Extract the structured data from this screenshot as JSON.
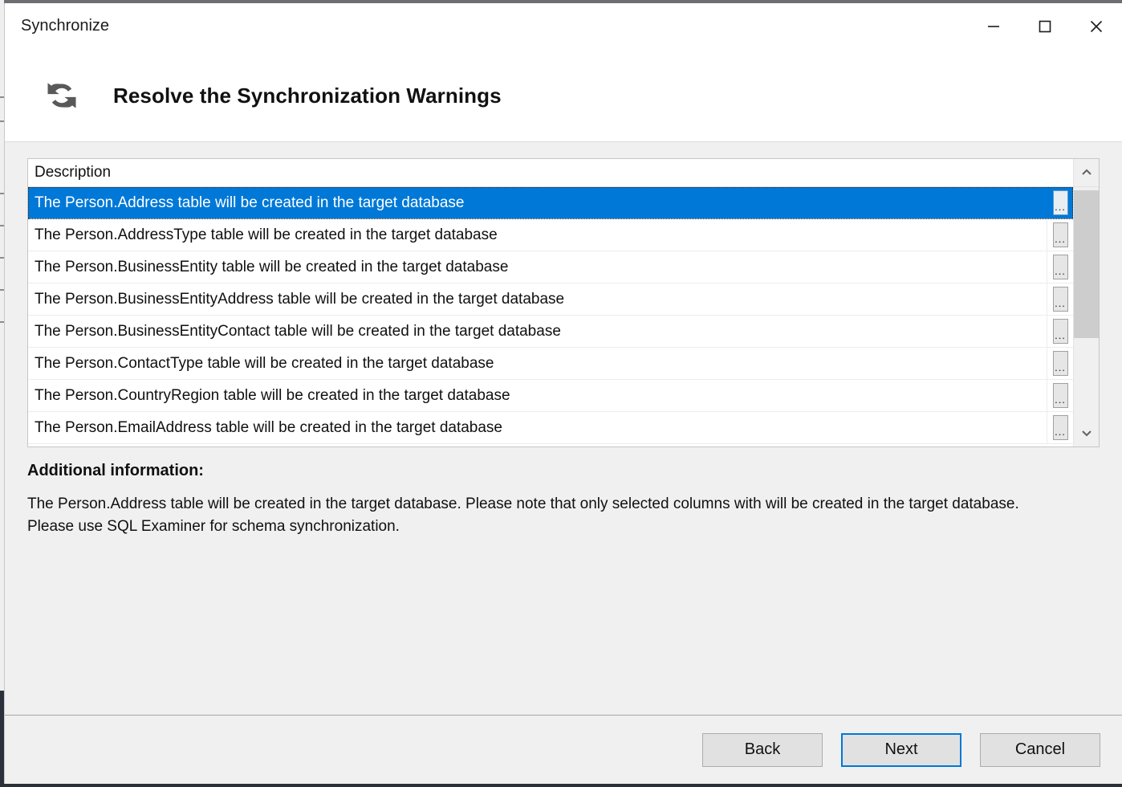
{
  "window": {
    "title": "Synchronize",
    "controls": {
      "minimize": "minimize-button",
      "maximize": "maximize-button",
      "close": "close-button"
    }
  },
  "header": {
    "icon": "sync-refresh-icon",
    "title": "Resolve the Synchronization Warnings"
  },
  "list": {
    "columns": [
      "Description"
    ],
    "rows": [
      {
        "description": "The Person.Address table will be created in the target database",
        "selected": true,
        "action_label": "..."
      },
      {
        "description": "The Person.AddressType table will be created in the target database",
        "selected": false,
        "action_label": "..."
      },
      {
        "description": "The Person.BusinessEntity table will be created in the target database",
        "selected": false,
        "action_label": "..."
      },
      {
        "description": "The Person.BusinessEntityAddress table will be created in the target database",
        "selected": false,
        "action_label": "..."
      },
      {
        "description": "The Person.BusinessEntityContact table will be created in the target database",
        "selected": false,
        "action_label": "..."
      },
      {
        "description": "The Person.ContactType table will be created in the target database",
        "selected": false,
        "action_label": "..."
      },
      {
        "description": "The Person.CountryRegion table will be created in the target database",
        "selected": false,
        "action_label": "..."
      },
      {
        "description": "The Person.EmailAddress table will be created in the target database",
        "selected": false,
        "action_label": "..."
      }
    ],
    "scrollbar": {
      "up_icon": "chevron-up-icon",
      "down_icon": "chevron-down-icon"
    }
  },
  "additional_information": {
    "label": "Additional information:",
    "text": "The Person.Address table will be created in the target database. Please note that only selected columns with will be created in the target database. Please use SQL Examiner for schema synchronization."
  },
  "footer": {
    "back_label": "Back",
    "next_label": "Next",
    "cancel_label": "Cancel",
    "default_button": "Next"
  },
  "colors": {
    "selection_blue": "#0078d7",
    "window_bg": "#f0f0f0",
    "panel_white": "#ffffff",
    "scrollbar_thumb": "#cdcdcd"
  }
}
